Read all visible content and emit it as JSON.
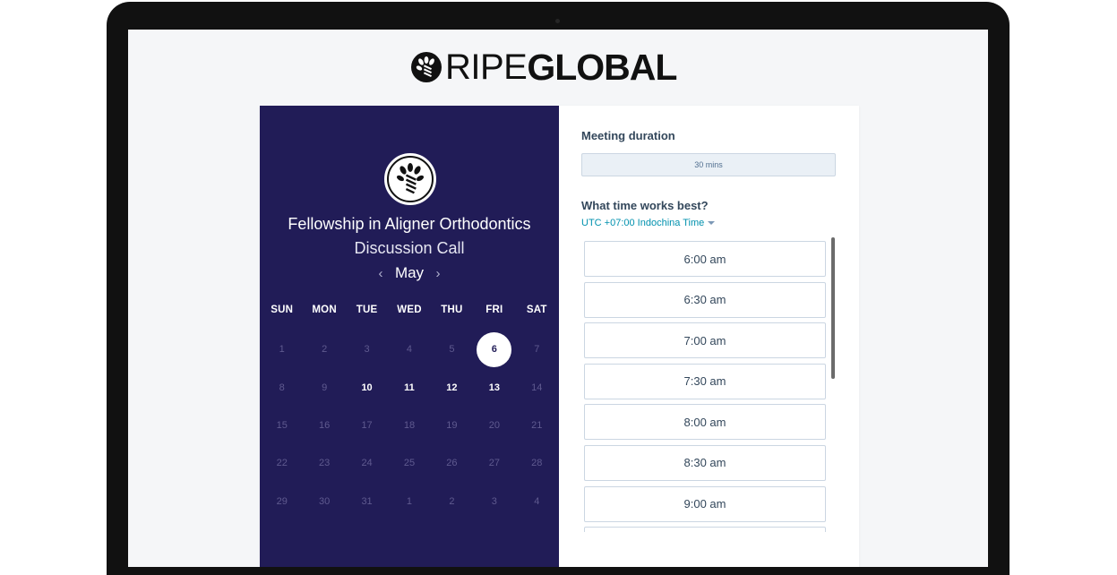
{
  "brand": {
    "name_light": "RIPE",
    "name_bold": "GLOBAL"
  },
  "event": {
    "title": "Fellowship in Aligner Orthodontics",
    "subtitle": "Discussion Call"
  },
  "calendar": {
    "month": "May",
    "prev_icon": "‹",
    "next_icon": "›",
    "weekdays": [
      "SUN",
      "MON",
      "TUE",
      "WED",
      "THU",
      "FRI",
      "SAT"
    ],
    "days": [
      {
        "label": "1",
        "state": "disabled"
      },
      {
        "label": "2",
        "state": "disabled"
      },
      {
        "label": "3",
        "state": "disabled"
      },
      {
        "label": "4",
        "state": "disabled"
      },
      {
        "label": "5",
        "state": "disabled"
      },
      {
        "label": "6",
        "state": "selected"
      },
      {
        "label": "7",
        "state": "disabled"
      },
      {
        "label": "8",
        "state": "disabled"
      },
      {
        "label": "9",
        "state": "disabled"
      },
      {
        "label": "10",
        "state": "available"
      },
      {
        "label": "11",
        "state": "available"
      },
      {
        "label": "12",
        "state": "available"
      },
      {
        "label": "13",
        "state": "available"
      },
      {
        "label": "14",
        "state": "disabled"
      },
      {
        "label": "15",
        "state": "disabled"
      },
      {
        "label": "16",
        "state": "disabled"
      },
      {
        "label": "17",
        "state": "disabled"
      },
      {
        "label": "18",
        "state": "disabled"
      },
      {
        "label": "19",
        "state": "disabled"
      },
      {
        "label": "20",
        "state": "disabled"
      },
      {
        "label": "21",
        "state": "disabled"
      },
      {
        "label": "22",
        "state": "disabled"
      },
      {
        "label": "23",
        "state": "disabled"
      },
      {
        "label": "24",
        "state": "disabled"
      },
      {
        "label": "25",
        "state": "disabled"
      },
      {
        "label": "26",
        "state": "disabled"
      },
      {
        "label": "27",
        "state": "disabled"
      },
      {
        "label": "28",
        "state": "disabled"
      },
      {
        "label": "29",
        "state": "disabled"
      },
      {
        "label": "30",
        "state": "disabled"
      },
      {
        "label": "31",
        "state": "disabled"
      },
      {
        "label": "1",
        "state": "disabled"
      },
      {
        "label": "2",
        "state": "disabled"
      },
      {
        "label": "3",
        "state": "disabled"
      },
      {
        "label": "4",
        "state": "disabled"
      }
    ]
  },
  "booking": {
    "duration_label": "Meeting duration",
    "duration_value": "30 mins",
    "time_label": "What time works best?",
    "timezone": "UTC +07:00 Indochina Time",
    "slots": [
      "6:00 am",
      "6:30 am",
      "7:00 am",
      "7:30 am",
      "8:00 am",
      "8:30 am",
      "9:00 am",
      ""
    ]
  },
  "colors": {
    "panel": "#211c57",
    "accent_link": "#0091ae",
    "text": "#33475b"
  }
}
